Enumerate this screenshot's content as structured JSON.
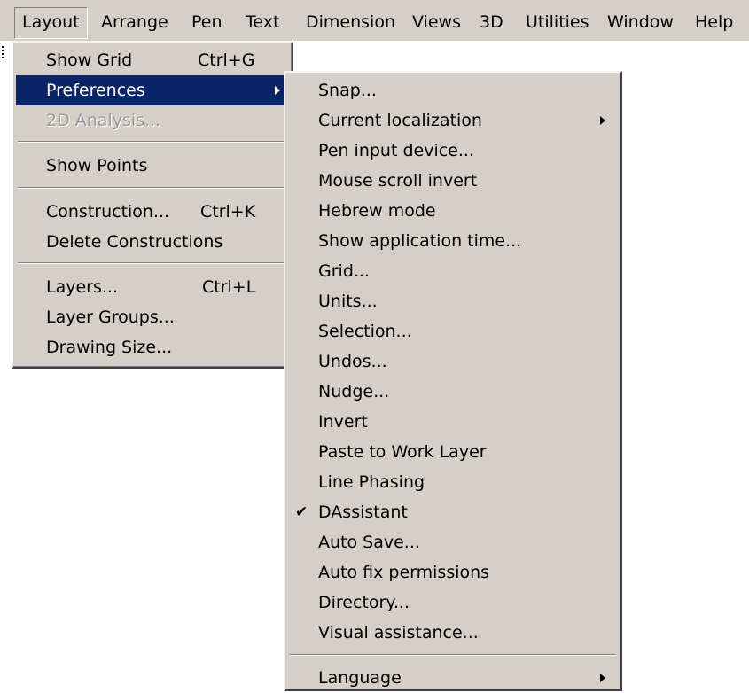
{
  "menubar": {
    "items": [
      "Layout",
      "Arrange",
      "Pen",
      "Text",
      "Dimension",
      "Views",
      "3D",
      "Utilities",
      "Window",
      "Help"
    ]
  },
  "layout_menu": {
    "show_grid": {
      "label": "Show Grid",
      "shortcut": "Ctrl+G"
    },
    "preferences": {
      "label": "Preferences"
    },
    "analysis_2d": {
      "label": "2D Analysis..."
    },
    "show_points": {
      "label": "Show Points"
    },
    "construction": {
      "label": "Construction...",
      "shortcut": "Ctrl+K"
    },
    "delete_constructions": {
      "label": "Delete Constructions"
    },
    "layers": {
      "label": "Layers...",
      "shortcut": "Ctrl+L"
    },
    "layer_groups": {
      "label": "Layer Groups..."
    },
    "drawing_size": {
      "label": "Drawing Size..."
    }
  },
  "preferences_menu": {
    "items": [
      {
        "label": "Snap..."
      },
      {
        "label": "Current localization",
        "submenu": true
      },
      {
        "label": "Pen input device..."
      },
      {
        "label": "Mouse scroll invert"
      },
      {
        "label": "Hebrew mode"
      },
      {
        "label": "Show application time..."
      },
      {
        "label": "Grid..."
      },
      {
        "label": "Units..."
      },
      {
        "label": "Selection..."
      },
      {
        "label": "Undos..."
      },
      {
        "label": "Nudge..."
      },
      {
        "label": "Invert"
      },
      {
        "label": "Paste to Work Layer"
      },
      {
        "label": "Line Phasing"
      },
      {
        "label": "DAssistant",
        "checked": true
      },
      {
        "label": "Auto Save..."
      },
      {
        "label": "Auto fix permissions"
      },
      {
        "label": "Directory..."
      },
      {
        "label": "Visual assistance..."
      },
      {
        "label": "Language",
        "submenu": true
      }
    ],
    "check_glyph": "✔"
  },
  "colors": {
    "menu_bg": "#d4d0c8",
    "highlight": "#0a246a",
    "disabled_text": "#9a9a9a"
  }
}
